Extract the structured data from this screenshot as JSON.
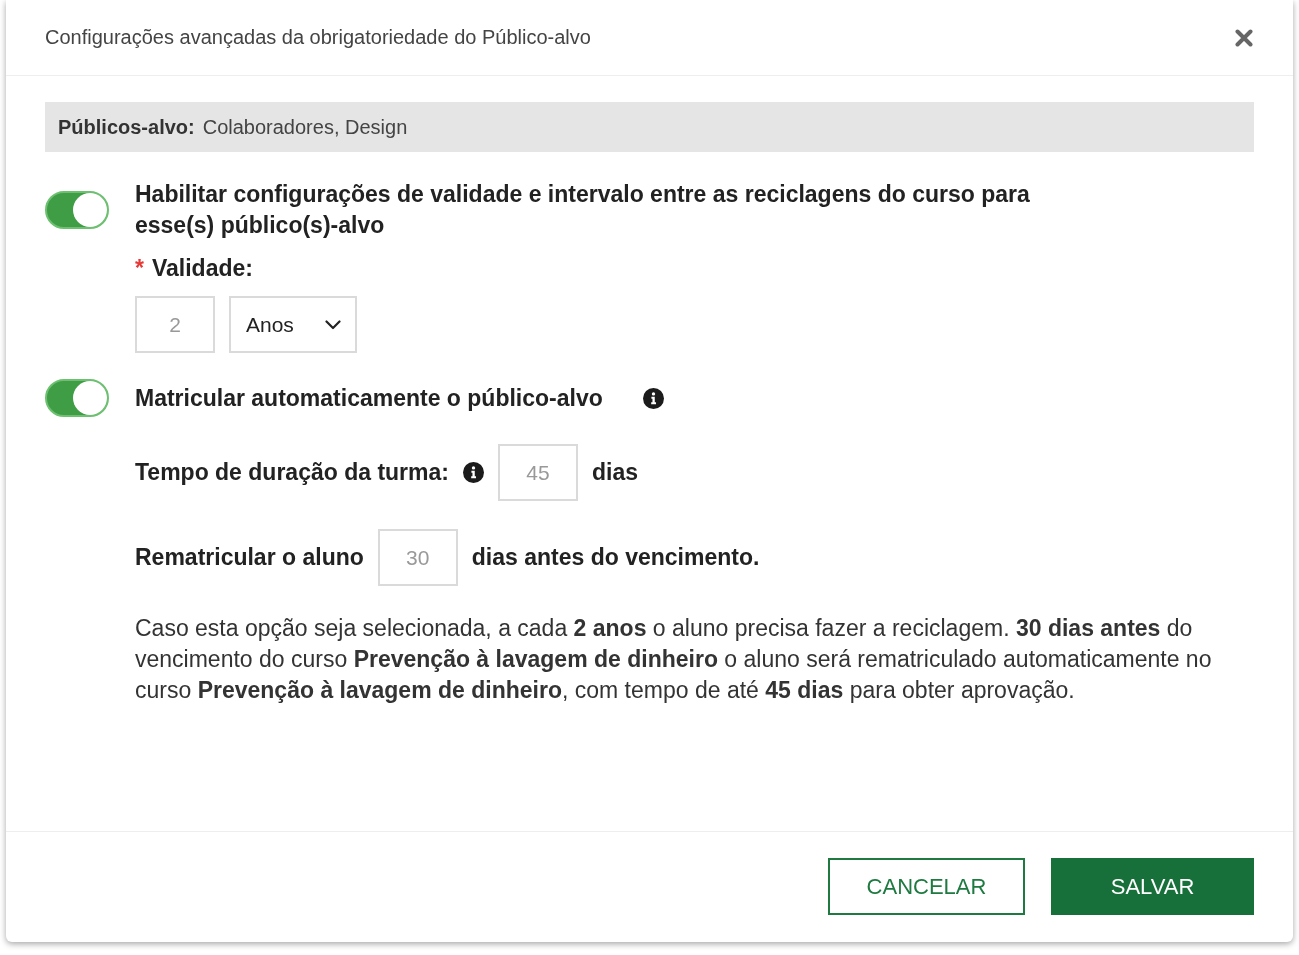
{
  "dialog": {
    "title": "Configurações avançadas da obrigatoriedade do Público-alvo"
  },
  "audience": {
    "label": "Públicos-alvo:",
    "value": "Colaboradores, Design"
  },
  "validity_setting": {
    "on": true,
    "label": "Habilitar configurações de validade e intervalo entre as reciclagens do curso para esse(s) público(s)-alvo"
  },
  "validity": {
    "required_mark": "*",
    "label": "Validade:",
    "amount": "2",
    "unit": "Anos"
  },
  "auto_enroll": {
    "on": true,
    "label": "Matricular automaticamente o público-alvo"
  },
  "class_duration": {
    "label": "Tempo de duração da turma:",
    "value": "45",
    "unit": "dias"
  },
  "reenroll": {
    "label": "Rematricular o aluno",
    "value": "30",
    "suffix": "dias antes do vencimento."
  },
  "explanation": "Caso esta opção seja selecionada, a cada **2 anos** o aluno precisa fazer a reciclagem. **30 dias antes** do vencimento do curso **Prevenção à lavagem de dinheiro** o aluno será rematriculado automaticamente no curso **Prevenção à lavagem de dinheiro**, com tempo de até **45 dias** para obter aprovação.",
  "buttons": [
    {
      "label": "CANCELAR",
      "kind": "secondary"
    },
    {
      "label": "SALVAR",
      "kind": "primary"
    }
  ]
}
